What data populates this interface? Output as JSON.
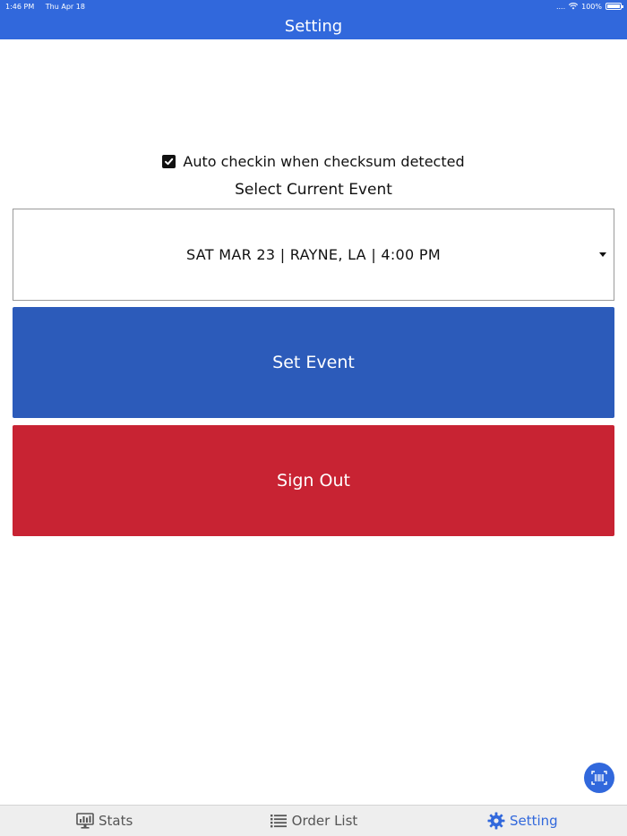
{
  "status_bar": {
    "time": "1:46 PM",
    "date": "Thu Apr 18",
    "signal": "....",
    "battery": "100%"
  },
  "header": {
    "title": "Setting"
  },
  "settings": {
    "auto_checkin_label": "Auto checkin when checksum detected",
    "auto_checkin_checked": true,
    "select_label": "Select Current Event",
    "selected_event": "SAT MAR 23 | RAYNE, LA | 4:00 PM"
  },
  "buttons": {
    "set_event": "Set Event",
    "sign_out": "Sign Out"
  },
  "colors": {
    "primary": "#3168dc",
    "set_event_bg": "#2c5bba",
    "sign_out_bg": "#c82333"
  },
  "tabs": [
    {
      "label": "Stats",
      "icon": "monitor-chart-icon",
      "active": false
    },
    {
      "label": "Order List",
      "icon": "list-icon",
      "active": false
    },
    {
      "label": "Setting",
      "icon": "gear-icon",
      "active": true
    }
  ],
  "fab": {
    "icon": "barcode-scan-icon"
  }
}
